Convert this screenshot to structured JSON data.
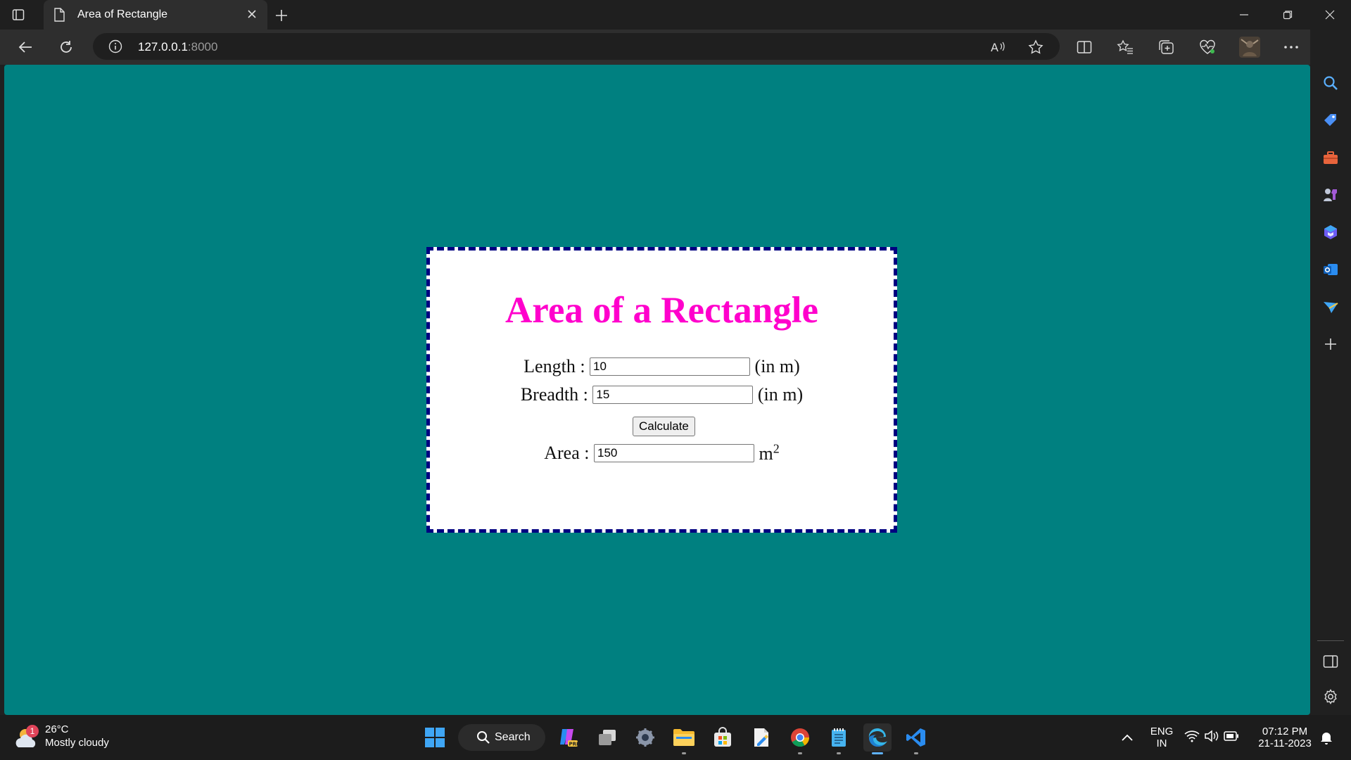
{
  "browser": {
    "tab": {
      "title": "Area of Rectangle"
    },
    "address": {
      "host": "127.0.0.1",
      "port": ":8000"
    }
  },
  "page": {
    "title": "Area of a Rectangle",
    "length": {
      "label": "Length :",
      "value": "10",
      "unit": "(in m)"
    },
    "breadth": {
      "label": "Breadth :",
      "value": "15",
      "unit": "(in m)"
    },
    "calculate_label": "Calculate",
    "area": {
      "label": "Area :",
      "value": "150",
      "unit": "m",
      "unit_sup": "2"
    },
    "colors": {
      "background": "#008080",
      "heading": "#ff00cc",
      "border": "#000080"
    }
  },
  "taskbar": {
    "weather": {
      "badge": "1",
      "temp": "26°C",
      "condition": "Mostly cloudy"
    },
    "search_label": "Search",
    "language": {
      "line1": "ENG",
      "line2": "IN"
    },
    "clock": {
      "time": "07:12 PM",
      "date": "21-11-2023"
    }
  }
}
